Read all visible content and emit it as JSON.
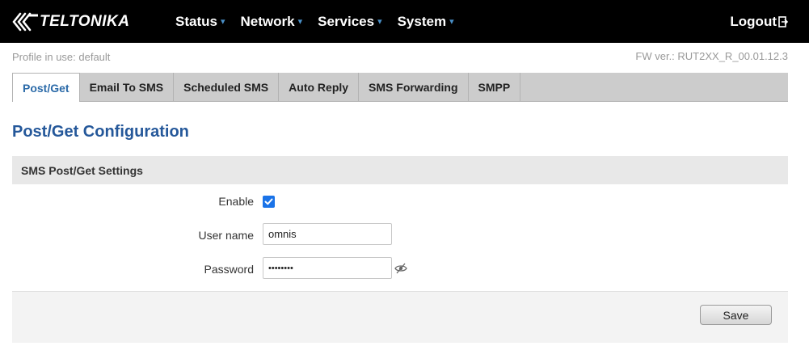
{
  "brand": {
    "name": "TELTONIKA"
  },
  "nav": {
    "items": [
      {
        "label": "Status"
      },
      {
        "label": "Network"
      },
      {
        "label": "Services"
      },
      {
        "label": "System"
      }
    ],
    "logout_label": "Logout"
  },
  "info": {
    "profile": "Profile in use: default",
    "firmware": "FW ver.: RUT2XX_R_00.01.12.3"
  },
  "tabs": [
    {
      "label": "Post/Get",
      "active": true
    },
    {
      "label": "Email To SMS",
      "active": false
    },
    {
      "label": "Scheduled SMS",
      "active": false
    },
    {
      "label": "Auto Reply",
      "active": false
    },
    {
      "label": "SMS Forwarding",
      "active": false
    },
    {
      "label": "SMPP",
      "active": false
    }
  ],
  "page": {
    "title": "Post/Get Configuration",
    "section_title": "SMS Post/Get Settings"
  },
  "form": {
    "enable_label": "Enable",
    "enable_checked": true,
    "username_label": "User name",
    "username_value": "omnis",
    "password_label": "Password",
    "password_value": "••••••••"
  },
  "actions": {
    "save_label": "Save"
  },
  "colors": {
    "topbar": "#000000",
    "accent": "#25589a",
    "active_tab_text": "#2b6aa8",
    "checkbox": "#1a73e8",
    "nav_caret": "#4a90c8"
  }
}
